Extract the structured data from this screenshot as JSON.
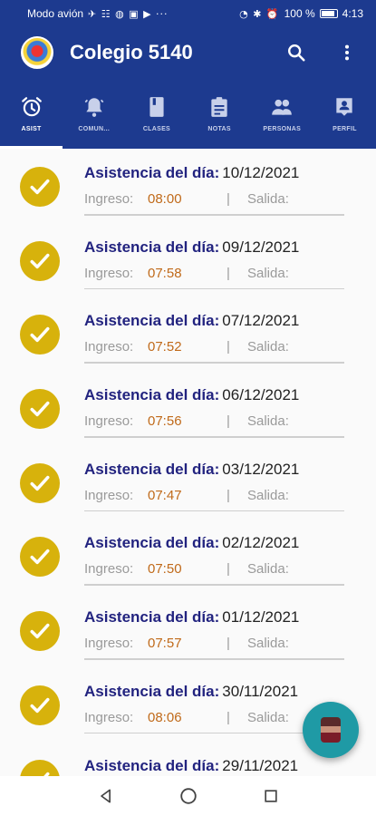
{
  "status_bar": {
    "carrier": "Modo avión",
    "battery": "100 %",
    "time": "4:13"
  },
  "app_bar": {
    "title": "Colegio 5140",
    "icons": [
      "school-logo",
      "search-icon",
      "more-vert-icon"
    ]
  },
  "tabs": [
    {
      "label": "ASIST",
      "icon": "alarm-icon",
      "active": true
    },
    {
      "label": "COMUN...",
      "icon": "bell-icon",
      "active": false
    },
    {
      "label": "CLASES",
      "icon": "book-icon",
      "active": false
    },
    {
      "label": "NOTAS",
      "icon": "clipboard-icon",
      "active": false
    },
    {
      "label": "PERSONAS",
      "icon": "people-icon",
      "active": false
    },
    {
      "label": "PERFIL",
      "icon": "profile-icon",
      "active": false
    }
  ],
  "attendance": {
    "title_label": "Asistencia del día:",
    "in_label": "Ingreso:",
    "separator": "|",
    "out_label": "Salida:",
    "entries": [
      {
        "date": "10/12/2021",
        "in_time": "08:00",
        "out_time": ""
      },
      {
        "date": "09/12/2021",
        "in_time": "07:58",
        "out_time": ""
      },
      {
        "date": "07/12/2021",
        "in_time": "07:52",
        "out_time": ""
      },
      {
        "date": "06/12/2021",
        "in_time": "07:56",
        "out_time": ""
      },
      {
        "date": "03/12/2021",
        "in_time": "07:47",
        "out_time": ""
      },
      {
        "date": "02/12/2021",
        "in_time": "07:50",
        "out_time": ""
      },
      {
        "date": "01/12/2021",
        "in_time": "07:57",
        "out_time": ""
      },
      {
        "date": "30/11/2021",
        "in_time": "08:06",
        "out_time": ""
      },
      {
        "date": "29/11/2021",
        "in_time": "",
        "out_time": ""
      }
    ]
  },
  "colors": {
    "primary": "#1d3a8f",
    "check": "#d7b20c",
    "title_text": "#22237f",
    "time_text": "#c06a1a",
    "fab": "#1f9aa5"
  },
  "fab": {
    "icon": "user-photo-avatar"
  },
  "nav": [
    "back-icon",
    "home-icon",
    "recents-icon"
  ]
}
